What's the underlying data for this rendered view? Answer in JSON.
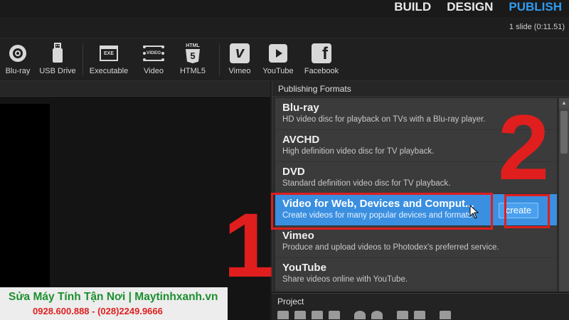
{
  "modes": [
    {
      "label": "BUILD"
    },
    {
      "label": "DESIGN"
    },
    {
      "label": "PUBLISH"
    }
  ],
  "slide_count": "1 slide (0:11.51)",
  "toolbar": {
    "items": [
      {
        "label": "Blu-ray",
        "icon": "disc-icon"
      },
      {
        "label": "USB Drive",
        "icon": "usb-icon"
      },
      {
        "label": "Executable",
        "icon": "exe-icon"
      },
      {
        "label": "Video",
        "icon": "video-icon"
      },
      {
        "label": "HTML5",
        "icon": "html5-icon"
      },
      {
        "label": "Vimeo",
        "icon": "vimeo-icon"
      },
      {
        "label": "YouTube",
        "icon": "youtube-icon"
      },
      {
        "label": "Facebook",
        "icon": "facebook-icon"
      }
    ],
    "icon_texts": {
      "exe": "EXE",
      "video": "VIDEO",
      "html": "HTML",
      "html_num": "5",
      "vimeo": "v",
      "facebook": "f"
    }
  },
  "publishing": {
    "title": "Publishing Formats",
    "items": [
      {
        "name": "Blu-ray",
        "desc": "HD video disc for playback on TVs with a Blu-ray player."
      },
      {
        "name": "AVCHD",
        "desc": "High definition video disc for TV playback."
      },
      {
        "name": "DVD",
        "desc": "Standard definition video disc for TV playback."
      },
      {
        "name": "Video for Web, Devices and Comput...",
        "desc": "Create videos for many popular devices and formats"
      },
      {
        "name": "Vimeo",
        "desc": "Produce and upload videos to Photodex's preferred service."
      },
      {
        "name": "YouTube",
        "desc": "Share videos online with YouTube."
      }
    ],
    "create_label": "create"
  },
  "annotations": {
    "step1": "1",
    "step2": "2"
  },
  "project": {
    "title": "Project"
  },
  "watermark": {
    "line1": "Sửa Máy Tính Tận Nơi | Maytinhxanh.vn",
    "line2": "0928.600.888 - (028)2249.9666"
  },
  "colors": {
    "accent": "#2f9bf0",
    "selected": "#3a8fe0",
    "annotation": "#e01e1e"
  }
}
